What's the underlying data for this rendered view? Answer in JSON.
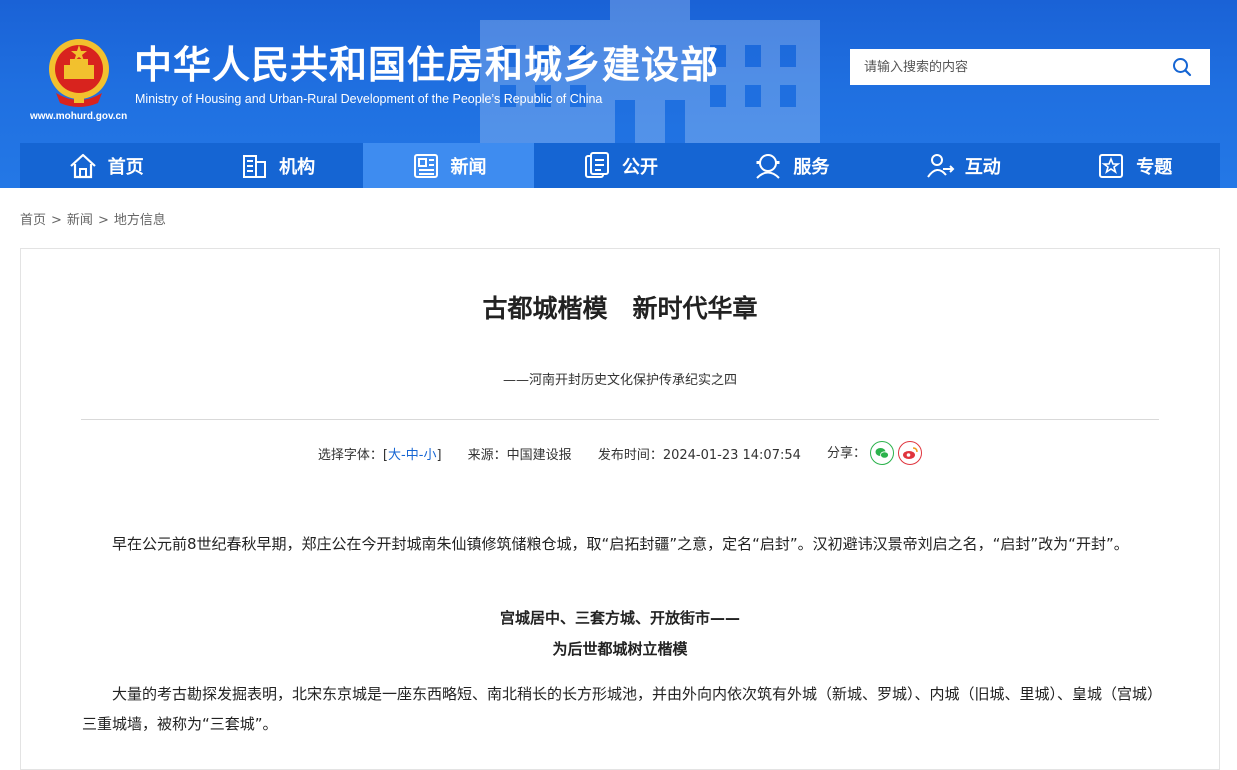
{
  "site": {
    "title": "中华人民共和国住房和城乡建设部",
    "subtitle": "Ministry of Housing and Urban-Rural Development of the People’s Republic of China",
    "url": "www.mohurd.gov.cn"
  },
  "search": {
    "placeholder": "请输入搜索的内容"
  },
  "nav": {
    "items": [
      {
        "label": "首页",
        "icon": "home-icon"
      },
      {
        "label": "机构",
        "icon": "building-icon"
      },
      {
        "label": "新闻",
        "icon": "news-icon",
        "active": true
      },
      {
        "label": "公开",
        "icon": "document-icon"
      },
      {
        "label": "服务",
        "icon": "service-icon"
      },
      {
        "label": "互动",
        "icon": "interaction-icon"
      },
      {
        "label": "专题",
        "icon": "topic-star-icon"
      }
    ]
  },
  "breadcrumb": {
    "home": "首页",
    "news": "新闻",
    "current": "地方信息",
    "separator": ">"
  },
  "article": {
    "title": "古都城楷模　新时代华章",
    "subtitle": "——河南开封历史文化保护传承纪实之四",
    "meta": {
      "font_label": "选择字体：[",
      "font_large": "大",
      "font_medium": "中",
      "font_small": "小",
      "font_dash": "-",
      "font_close": "]",
      "source": "来源：中国建设报",
      "published": "发布时间：2024-01-23 14:07:54",
      "share_label": "分享："
    },
    "paragraph1": "早在公元前8世纪春秋早期，郑庄公在今开封城南朱仙镇修筑储粮仓城，取“启拓封疆”之意，定名“启封”。汉初避讳汉景帝刘启之名，“启封”改为“开封”。",
    "heading_line1": "宫城居中、三套方城、开放街市——",
    "heading_line2": "为后世都城树立楷模",
    "paragraph2": "大量的考古勘探发掘表明，北宋东京城是一座东西略短、南北稍长的长方形城池，并由外向内依次筑有外城（新城、罗城）、内城（旧城、里城）、皇城（宫城）三重城墙，被称为“三套城”。"
  },
  "colors": {
    "header_blue": "#1f6fe0",
    "nav_blue": "#1565d3",
    "nav_active": "#3e8cf0",
    "link": "#1565d3"
  }
}
